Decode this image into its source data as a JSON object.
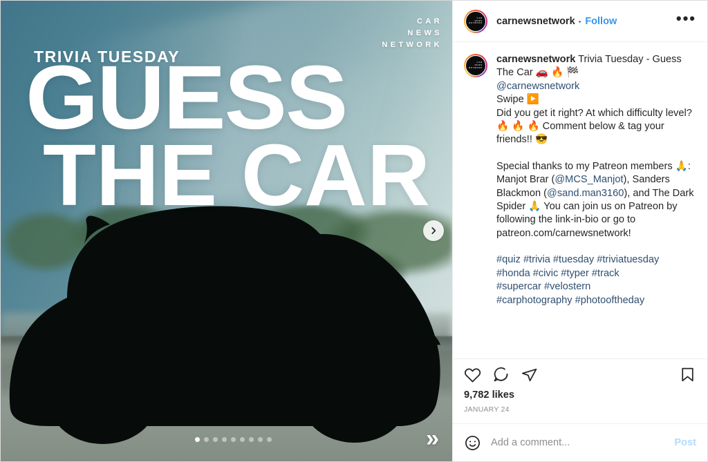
{
  "header": {
    "username": "carnewsnetwork",
    "separator": "·",
    "follow_label": "Follow",
    "more_label": "•••"
  },
  "media": {
    "watermark": [
      "CAR",
      "NEWS",
      "NETWORK"
    ],
    "kicker": "TRIVIA TUESDAY",
    "headline_line1": "GUESS",
    "headline_line2": "THE CAR",
    "swipe_chevrons": "»",
    "carousel": {
      "count": 9,
      "active_index": 0
    },
    "colors": {
      "sky_top": "#41768a",
      "sky_right": "#d9e3e1",
      "trees": "#22402f",
      "asphalt": "#8e9a92",
      "silhouette": "#060b09"
    }
  },
  "caption": {
    "username": "carnewsnetwork",
    "line_title": " Trivia Tuesday - Guess The Car 🚗 🔥 🏁",
    "mention_main": "@carnewsnetwork",
    "line_swipe": "Swipe ▶️",
    "line_question": "Did you get it right? At which difficulty level? 🔥 🔥 🔥 Comment below & tag your friends!! 😎",
    "thanks_pre": "Special thanks to my Patreon members 🙏: Manjot Brar (",
    "thanks_m1": "@MCS_Manjot",
    "thanks_mid": "), Sanders Blackmon (",
    "thanks_m2": "@sand.man3160",
    "thanks_post": "), and The Dark Spider 🙏 You can join us on Patreon by following the link-in-bio or go to patreon.com/carnewsnetwork!",
    "hashtags_line1": "#quiz #trivia #tuesday #triviatuesday",
    "hashtags_line2": "#honda #civic #typer #track",
    "hashtags_line3": "#supercar #velostern",
    "hashtags_line4": "#carphotography #photooftheday"
  },
  "actions": {
    "like_icon": "heart-icon",
    "comment_icon": "comment-icon",
    "share_icon": "share-icon",
    "save_icon": "bookmark-icon",
    "likes": "9,782 likes",
    "date": "JANUARY 24"
  },
  "comment_bar": {
    "emoji_icon": "emoji-icon",
    "placeholder": "Add a comment...",
    "post_label": "Post"
  }
}
